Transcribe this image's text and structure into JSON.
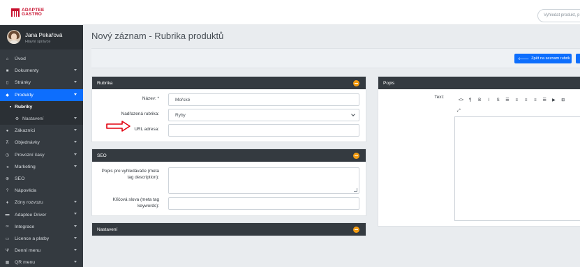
{
  "brand": {
    "line1": "ADAPTEE",
    "line2": "GASTRO"
  },
  "search": {
    "placeholder": "Vyhledat produkt, p"
  },
  "user": {
    "name": "Jana Pekařová",
    "role": "Hlavní správce"
  },
  "sidebar": {
    "items": [
      {
        "label": "Úvod",
        "icon": "home-icon",
        "glyph": "⌂",
        "chevron": false
      },
      {
        "label": "Dokumenty",
        "icon": "folder-icon",
        "glyph": "■",
        "chevron": true
      },
      {
        "label": "Stránky",
        "icon": "file-icon",
        "glyph": "▯",
        "chevron": true
      },
      {
        "label": "Produkty",
        "icon": "tag-icon",
        "glyph": "◆",
        "chevron": true,
        "active": true
      },
      {
        "label": "Rubriky",
        "icon": "bullet",
        "sub": true
      },
      {
        "label": "Nastavení",
        "icon": "cogs-icon",
        "glyph": "⚙",
        "chevron": true,
        "sub2": true
      },
      {
        "label": "Zákazníci",
        "icon": "user-icon",
        "glyph": "●",
        "chevron": true
      },
      {
        "label": "Objednávky",
        "icon": "cart-icon",
        "glyph": "⊼",
        "chevron": true
      },
      {
        "label": "Provozní časy",
        "icon": "clock-icon",
        "glyph": "◷",
        "chevron": true
      },
      {
        "label": "Marketing",
        "icon": "bullhorn-icon",
        "glyph": "◂",
        "chevron": true
      },
      {
        "label": "SEO",
        "icon": "search-icon",
        "glyph": "⊕",
        "chevron": false
      },
      {
        "label": "Nápověda",
        "icon": "question-icon",
        "glyph": "?",
        "chevron": false
      },
      {
        "label": "Zóny rozvozu",
        "icon": "map-pin-icon",
        "glyph": "♦",
        "chevron": true
      },
      {
        "label": "Adaptee Driver",
        "icon": "car-icon",
        "glyph": "▬",
        "chevron": true
      },
      {
        "label": "Integrace",
        "icon": "link-icon",
        "glyph": "∞",
        "chevron": true
      },
      {
        "label": "Licence a platby",
        "icon": "credit-card-icon",
        "glyph": "▭",
        "chevron": true
      },
      {
        "label": "Denní menu",
        "icon": "utensils-icon",
        "glyph": "Ψ",
        "chevron": true
      },
      {
        "label": "QR menu",
        "icon": "qr-icon",
        "glyph": "▦",
        "chevron": true
      }
    ]
  },
  "page": {
    "title": "Nový záznam - Rubrika produktů"
  },
  "toolbar": {
    "back_label": "Zpět na seznam rubrik"
  },
  "rubrika_panel": {
    "title": "Rubrika",
    "name_label": "Název: *",
    "name_value": "Mořské",
    "parent_label": "Nadřazená rubrika:",
    "parent_value": "Ryby",
    "url_label": "URL adresa:",
    "url_value": ""
  },
  "seo_panel": {
    "title": "SEO",
    "description_label": "Popis pro vyhledávače (meta tag description):",
    "keywords_label": "Klíčová slova (meta tag keywords):"
  },
  "settings_panel": {
    "title": "Nastavení"
  },
  "popis_panel": {
    "title": "Popis",
    "text_label": "Text:",
    "tools": [
      "<>",
      "¶",
      "B",
      "I",
      "S",
      "☰",
      "≡",
      "≡",
      "≡",
      "☰",
      "▶",
      "⊞"
    ],
    "expand": "⤢"
  }
}
